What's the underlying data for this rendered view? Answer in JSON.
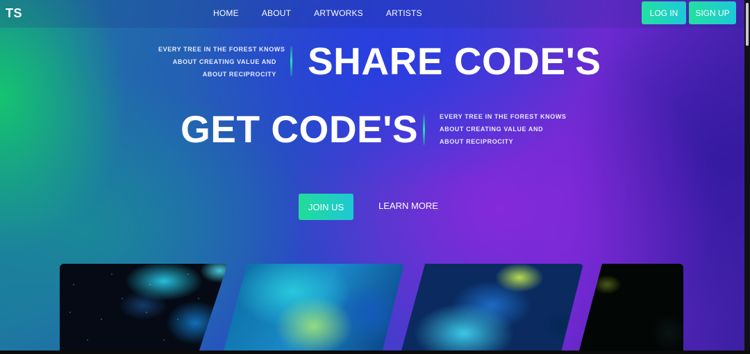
{
  "brand": {
    "logo": "TS"
  },
  "nav": {
    "items": [
      {
        "label": "HOME"
      },
      {
        "label": "ABOUT"
      },
      {
        "label": "ARTWORKS"
      },
      {
        "label": "ARTISTS"
      }
    ]
  },
  "auth": {
    "login_label": "LOG IN",
    "signup_label": "SIGN UP"
  },
  "hero": {
    "share": {
      "headline": "SHARE CODE'S",
      "tagline": [
        "EVERY TREE IN THE FOREST KNOWS",
        "ABOUT CREATING VALUE AND",
        "ABOUT RECIPROCITY"
      ]
    },
    "get": {
      "headline": "GET CODE'S",
      "tagline": [
        "EVERY TREE IN THE FOREST KNOWS",
        "ABOUT CREATING VALUE AND",
        "ABOUT RECIPROCITY"
      ]
    },
    "join_label": "JOIN US",
    "learn_label": "LEARN MORE"
  },
  "colors": {
    "accent_start": "#22e0a0",
    "accent_end": "#1ec8d8"
  }
}
